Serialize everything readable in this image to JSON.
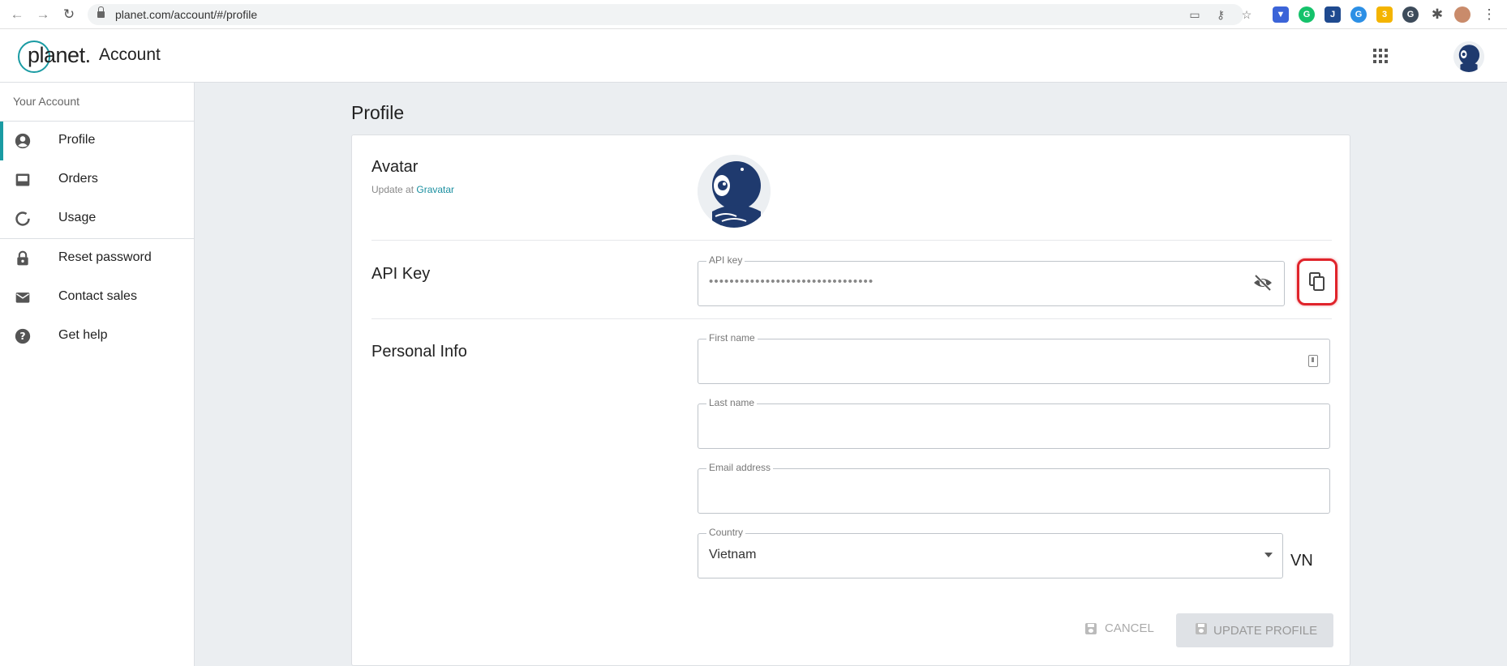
{
  "browser": {
    "url": "planet.com/account/#/profile",
    "extensions": [
      {
        "name": "pocket-icon",
        "color": "#3b64d8",
        "glyph": "▼"
      },
      {
        "name": "grammarly-icon",
        "color": "#15c26b",
        "glyph": "G"
      },
      {
        "name": "bookmark-ext-icon",
        "color": "#1f4a8f",
        "glyph": "J"
      },
      {
        "name": "chrome-ext-icon",
        "color": "#2c8fe5",
        "glyph": "G"
      },
      {
        "name": "note-ext-icon",
        "color": "#f4b400",
        "glyph": "3"
      },
      {
        "name": "shield-ext-icon",
        "color": "#3d4b5a",
        "glyph": "G"
      }
    ]
  },
  "header": {
    "logo_text": "planet.",
    "title": "Account"
  },
  "sidebar": {
    "heading": "Your Account",
    "items": [
      {
        "label": "Profile",
        "icon": "account-circle-icon"
      },
      {
        "label": "Orders",
        "icon": "inbox-icon"
      },
      {
        "label": "Usage",
        "icon": "usage-ring-icon"
      },
      {
        "label": "Reset password",
        "icon": "lock-icon"
      },
      {
        "label": "Contact sales",
        "icon": "mail-icon"
      },
      {
        "label": "Get help",
        "icon": "help-icon"
      }
    ]
  },
  "main": {
    "page_title": "Profile",
    "avatar": {
      "title": "Avatar",
      "update_prefix": "Update at ",
      "update_link": "Gravatar"
    },
    "api_key": {
      "title": "API Key",
      "label": "API key",
      "masked_value": "••••••••••••••••••••••••••••••••"
    },
    "personal_info": {
      "title": "Personal Info",
      "first_name": {
        "label": "First name",
        "value": ""
      },
      "last_name": {
        "label": "Last name",
        "value": ""
      },
      "email": {
        "label": "Email address",
        "value": ""
      },
      "country": {
        "label": "Country",
        "value": "Vietnam",
        "code": "VN"
      }
    },
    "actions": {
      "cancel": "CANCEL",
      "update": "UPDATE PROFILE"
    }
  },
  "colors": {
    "accent": "#1a9ba3",
    "highlight": "#e0242b",
    "avatar_navy": "#1f3a6e"
  }
}
